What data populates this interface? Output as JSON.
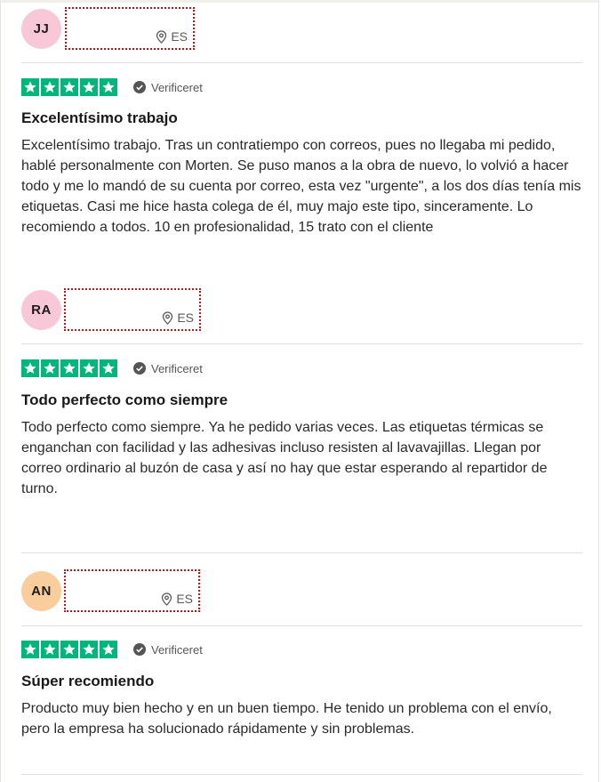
{
  "reviews": [
    {
      "initials": "JJ",
      "avatar_color": "#f8c8d8",
      "country": "ES",
      "verified_label": "Verificeret",
      "stars": 5,
      "title": "Excelentísimo trabajo",
      "body": "Excelentísimo trabajo. Tras un contratiempo con correos, pues no llegaba mi pedido, hablé personalmente con Morten. Se puso manos a la obra de nuevo, lo volvió a hacer todo y me lo mandó de su cuenta por correo, esta vez \"urgente\", a los dos días tenía mis etiquetas. Casi me hice hasta colega de él, muy majo este tipo, sinceramente. Lo recomiendo a todos. 10 en profesionalidad, 15 trato con el cliente"
    },
    {
      "initials": "RA",
      "avatar_color": "#f8c8d8",
      "country": "ES",
      "verified_label": "Verificeret",
      "stars": 5,
      "title": "Todo perfecto como siempre",
      "body": "Todo perfecto como siempre. Ya he pedido varias veces. Las etiquetas térmicas se enganchan con facilidad y las adhesivas incluso resisten al lavavajillas. Llegan por correo ordinario al buzón de casa y así no hay que estar esperando al repartidor de turno."
    },
    {
      "initials": "AN",
      "avatar_color": "#f9cd9c",
      "country": "ES",
      "verified_label": "Verificeret",
      "stars": 5,
      "title": "Súper recomiendo",
      "body": "Producto muy bien hecho y en un buen tiempo. He tenido un problema con el envío, pero la empresa ha solucionado rápidamente y sin problemas."
    }
  ],
  "colors": {
    "star_green": "#00b67a",
    "redaction_border": "#b01a1a"
  }
}
